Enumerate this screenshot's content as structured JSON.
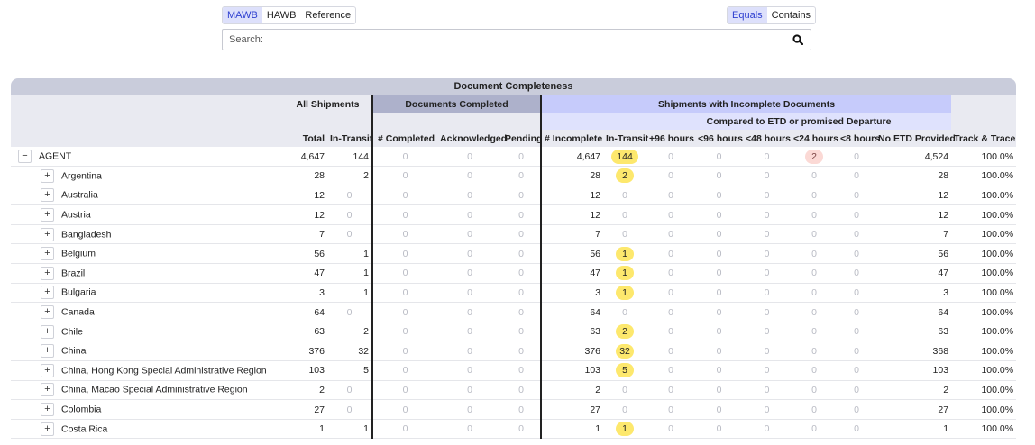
{
  "toggles": {
    "id_type": [
      "MAWB",
      "HAWB",
      "Reference"
    ],
    "match_mode": [
      "Equals",
      "Contains"
    ]
  },
  "search": {
    "placeholder": "Search:",
    "icon": "search-icon"
  },
  "table": {
    "title": "Document Completeness",
    "groups": {
      "all": "All Shipments",
      "completed": "Documents Completed",
      "incomplete": "Shipments with Incomplete Documents",
      "compared": "Compared to ETD or promised Departure"
    },
    "columns": [
      "Total",
      "In-Transit",
      "# Completed",
      "Acknowledged",
      "Pending",
      "# Incomplete",
      "In-Transit",
      "+96 hours",
      "<96 hours",
      "<48 hours",
      "<24 hours",
      "<8 hours",
      "No ETD Provided",
      "Track & Trace"
    ],
    "rows": [
      {
        "name": "AGENT",
        "expander": "−",
        "level": 0,
        "total": "4,647",
        "transit": "144",
        "completed": "0",
        "ack": "0",
        "pending": "0",
        "incomplete": "4,647",
        "inc_transit": "144",
        "h96p": "0",
        "h96": "0",
        "h48": "0",
        "h24": "2",
        "h8": "0",
        "noetd": "4,524",
        "tt": "100.0%"
      },
      {
        "name": "Argentina",
        "expander": "+",
        "level": 1,
        "total": "28",
        "transit": "2",
        "completed": "0",
        "ack": "0",
        "pending": "0",
        "incomplete": "28",
        "inc_transit": "2",
        "h96p": "0",
        "h96": "0",
        "h48": "0",
        "h24": "0",
        "h8": "0",
        "noetd": "28",
        "tt": "100.0%"
      },
      {
        "name": "Australia",
        "expander": "+",
        "level": 1,
        "total": "12",
        "transit": "0",
        "completed": "0",
        "ack": "0",
        "pending": "0",
        "incomplete": "12",
        "inc_transit": "0",
        "h96p": "0",
        "h96": "0",
        "h48": "0",
        "h24": "0",
        "h8": "0",
        "noetd": "12",
        "tt": "100.0%"
      },
      {
        "name": "Austria",
        "expander": "+",
        "level": 1,
        "total": "12",
        "transit": "0",
        "completed": "0",
        "ack": "0",
        "pending": "0",
        "incomplete": "12",
        "inc_transit": "0",
        "h96p": "0",
        "h96": "0",
        "h48": "0",
        "h24": "0",
        "h8": "0",
        "noetd": "12",
        "tt": "100.0%"
      },
      {
        "name": "Bangladesh",
        "expander": "+",
        "level": 1,
        "total": "7",
        "transit": "0",
        "completed": "0",
        "ack": "0",
        "pending": "0",
        "incomplete": "7",
        "inc_transit": "0",
        "h96p": "0",
        "h96": "0",
        "h48": "0",
        "h24": "0",
        "h8": "0",
        "noetd": "7",
        "tt": "100.0%"
      },
      {
        "name": "Belgium",
        "expander": "+",
        "level": 1,
        "total": "56",
        "transit": "1",
        "completed": "0",
        "ack": "0",
        "pending": "0",
        "incomplete": "56",
        "inc_transit": "1",
        "h96p": "0",
        "h96": "0",
        "h48": "0",
        "h24": "0",
        "h8": "0",
        "noetd": "56",
        "tt": "100.0%"
      },
      {
        "name": "Brazil",
        "expander": "+",
        "level": 1,
        "total": "47",
        "transit": "1",
        "completed": "0",
        "ack": "0",
        "pending": "0",
        "incomplete": "47",
        "inc_transit": "1",
        "h96p": "0",
        "h96": "0",
        "h48": "0",
        "h24": "0",
        "h8": "0",
        "noetd": "47",
        "tt": "100.0%"
      },
      {
        "name": "Bulgaria",
        "expander": "+",
        "level": 1,
        "total": "3",
        "transit": "1",
        "completed": "0",
        "ack": "0",
        "pending": "0",
        "incomplete": "3",
        "inc_transit": "1",
        "h96p": "0",
        "h96": "0",
        "h48": "0",
        "h24": "0",
        "h8": "0",
        "noetd": "3",
        "tt": "100.0%"
      },
      {
        "name": "Canada",
        "expander": "+",
        "level": 1,
        "total": "64",
        "transit": "0",
        "completed": "0",
        "ack": "0",
        "pending": "0",
        "incomplete": "64",
        "inc_transit": "0",
        "h96p": "0",
        "h96": "0",
        "h48": "0",
        "h24": "0",
        "h8": "0",
        "noetd": "64",
        "tt": "100.0%"
      },
      {
        "name": "Chile",
        "expander": "+",
        "level": 1,
        "total": "63",
        "transit": "2",
        "completed": "0",
        "ack": "0",
        "pending": "0",
        "incomplete": "63",
        "inc_transit": "2",
        "h96p": "0",
        "h96": "0",
        "h48": "0",
        "h24": "0",
        "h8": "0",
        "noetd": "63",
        "tt": "100.0%"
      },
      {
        "name": "China",
        "expander": "+",
        "level": 1,
        "total": "376",
        "transit": "32",
        "completed": "0",
        "ack": "0",
        "pending": "0",
        "incomplete": "376",
        "inc_transit": "32",
        "h96p": "0",
        "h96": "0",
        "h48": "0",
        "h24": "0",
        "h8": "0",
        "noetd": "368",
        "tt": "100.0%"
      },
      {
        "name": "China, Hong Kong Special Administrative Region",
        "expander": "+",
        "level": 1,
        "total": "103",
        "transit": "5",
        "completed": "0",
        "ack": "0",
        "pending": "0",
        "incomplete": "103",
        "inc_transit": "5",
        "h96p": "0",
        "h96": "0",
        "h48": "0",
        "h24": "0",
        "h8": "0",
        "noetd": "103",
        "tt": "100.0%"
      },
      {
        "name": "China, Macao Special Administrative Region",
        "expander": "+",
        "level": 1,
        "total": "2",
        "transit": "0",
        "completed": "0",
        "ack": "0",
        "pending": "0",
        "incomplete": "2",
        "inc_transit": "0",
        "h96p": "0",
        "h96": "0",
        "h48": "0",
        "h24": "0",
        "h8": "0",
        "noetd": "2",
        "tt": "100.0%"
      },
      {
        "name": "Colombia",
        "expander": "+",
        "level": 1,
        "total": "27",
        "transit": "0",
        "completed": "0",
        "ack": "0",
        "pending": "0",
        "incomplete": "27",
        "inc_transit": "0",
        "h96p": "0",
        "h96": "0",
        "h48": "0",
        "h24": "0",
        "h8": "0",
        "noetd": "27",
        "tt": "100.0%"
      },
      {
        "name": "Costa Rica",
        "expander": "+",
        "level": 1,
        "total": "1",
        "transit": "1",
        "completed": "0",
        "ack": "0",
        "pending": "0",
        "incomplete": "1",
        "inc_transit": "1",
        "h96p": "0",
        "h96": "0",
        "h48": "0",
        "h24": "0",
        "h8": "0",
        "noetd": "1",
        "tt": "100.0%"
      }
    ]
  },
  "colors": {
    "accent": "#2e3fd0",
    "highlight_yellow": "#fde86d",
    "highlight_pink": "#fbd9d5",
    "zero_text": "#b9bbc4"
  }
}
